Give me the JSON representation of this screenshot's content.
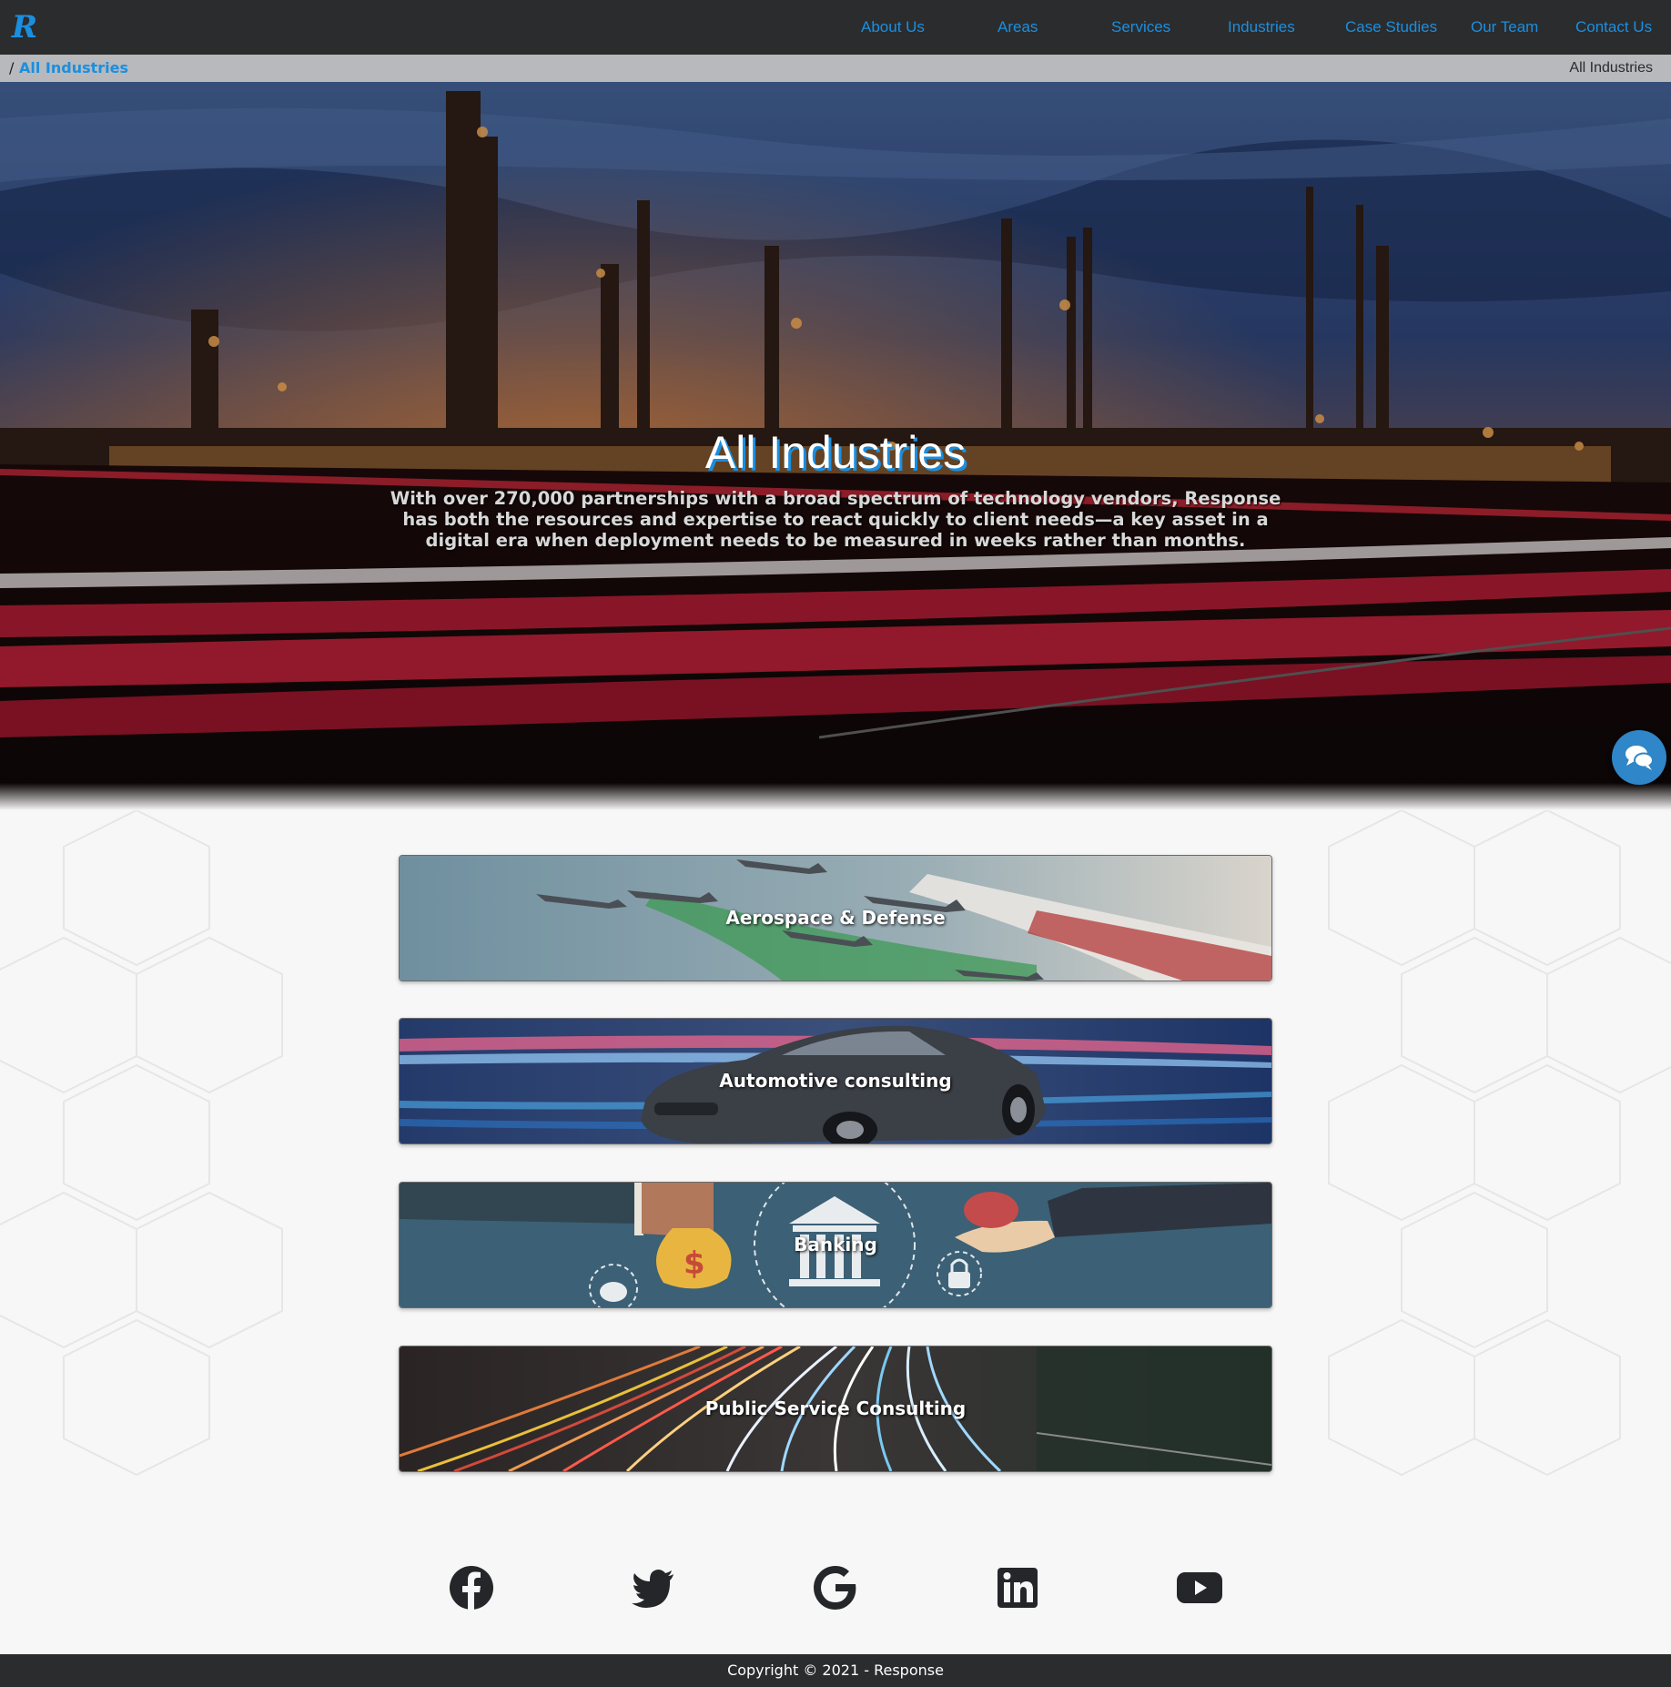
{
  "nav": {
    "logo": "R",
    "links": [
      {
        "label": "About Us"
      },
      {
        "label": "Areas"
      },
      {
        "label": "Services"
      },
      {
        "label": "Industries"
      },
      {
        "label": "Case Studies"
      },
      {
        "label": "Our Team"
      },
      {
        "label": "Contact Us"
      }
    ]
  },
  "breadcrumb": {
    "separator": "/",
    "current": "All Industries",
    "page_name": "All Industries"
  },
  "hero": {
    "title": "All Industries",
    "subtitle": "With over 270,000 partnerships with a broad spectrum of technology vendors, Response has both the resources and expertise to react quickly to client needs—a key asset in a digital era when deployment needs to be measured in weeks rather than months."
  },
  "industries": [
    {
      "label": "Aerospace & Defense"
    },
    {
      "label": "Automotive consulting"
    },
    {
      "label": "Banking"
    },
    {
      "label": "Public Service Consulting"
    }
  ],
  "social": [
    {
      "icon": "facebook-icon"
    },
    {
      "icon": "twitter-icon"
    },
    {
      "icon": "google-icon"
    },
    {
      "icon": "linkedin-icon"
    },
    {
      "icon": "youtube-icon"
    }
  ],
  "chat": {
    "icon": "chat-icon"
  },
  "footer": {
    "copyright": "Copyright © 2021 - Response"
  },
  "colors": {
    "nav_bg": "#2b2c2e",
    "accent": "#1a8fe0",
    "breadcrumb_bg": "#b7b9bd",
    "chat_bg": "#2f86c8"
  }
}
